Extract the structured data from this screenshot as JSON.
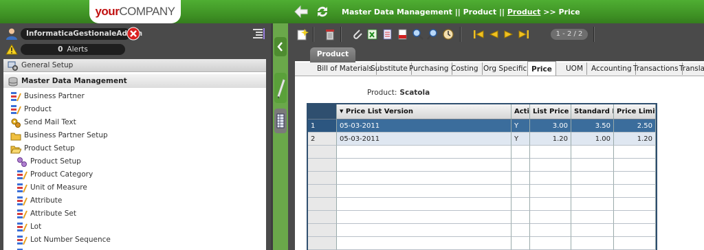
{
  "header": {
    "logo_your": "your",
    "logo_company": "COMPANY",
    "breadcrumb_part1": "Master Data Management || Product  ||",
    "breadcrumb_link": "Product",
    "breadcrumb_part2": ">> Price"
  },
  "user": {
    "name": "InformaticaGestionaleAdmin"
  },
  "alerts": {
    "count": "0",
    "label": "Alerts"
  },
  "menu": {
    "general_setup": "General Setup",
    "master_data_management": "Master Data Management",
    "items": [
      {
        "label": "Business Partner",
        "icon": "window-icon"
      },
      {
        "label": "Product",
        "icon": "window-icon"
      },
      {
        "label": "Send Mail Text",
        "icon": "process-icon"
      },
      {
        "label": "Business Partner Setup",
        "icon": "folder-icon"
      },
      {
        "label": "Product Setup",
        "icon": "folder-open-icon"
      },
      {
        "label": "Product Setup",
        "icon": "setup-icon"
      },
      {
        "label": "Product Category",
        "icon": "window-icon"
      },
      {
        "label": "Unit of Measure",
        "icon": "window-icon"
      },
      {
        "label": "Attribute",
        "icon": "window-icon"
      },
      {
        "label": "Attribute Set",
        "icon": "window-icon"
      },
      {
        "label": "Lot",
        "icon": "window-icon"
      },
      {
        "label": "Lot Number Sequence",
        "icon": "window-icon"
      }
    ]
  },
  "toolbar": {
    "record_counter": "1 - 2 / 2"
  },
  "tabs": {
    "main_tab": "Product",
    "subtabs": [
      "Bill of Materials",
      "Substitute",
      "Purchasing",
      "Costing",
      "Org Specific",
      "Price",
      "UOM",
      "Accounting",
      "Transactions",
      "Transla"
    ],
    "active_subtab": "Price"
  },
  "form": {
    "product_label": "Product:",
    "product_value": "Scatola"
  },
  "grid": {
    "columns": [
      "Price List Version",
      "Acti",
      "List Price",
      "Standard Pr",
      "Price Limit"
    ],
    "rows": [
      {
        "num": "1",
        "version": "05-03-2011",
        "active": "Y",
        "list": "3.00",
        "standard": "3.50",
        "limit": "2.50"
      },
      {
        "num": "2",
        "version": "05-03-2011",
        "active": "Y",
        "list": "1.20",
        "standard": "1.00",
        "limit": "1.20"
      }
    ]
  },
  "colors": {
    "brand_green": "#3d8f23",
    "selected_row": "#3b6d9c",
    "panel_dark": "#4a4a4a"
  }
}
